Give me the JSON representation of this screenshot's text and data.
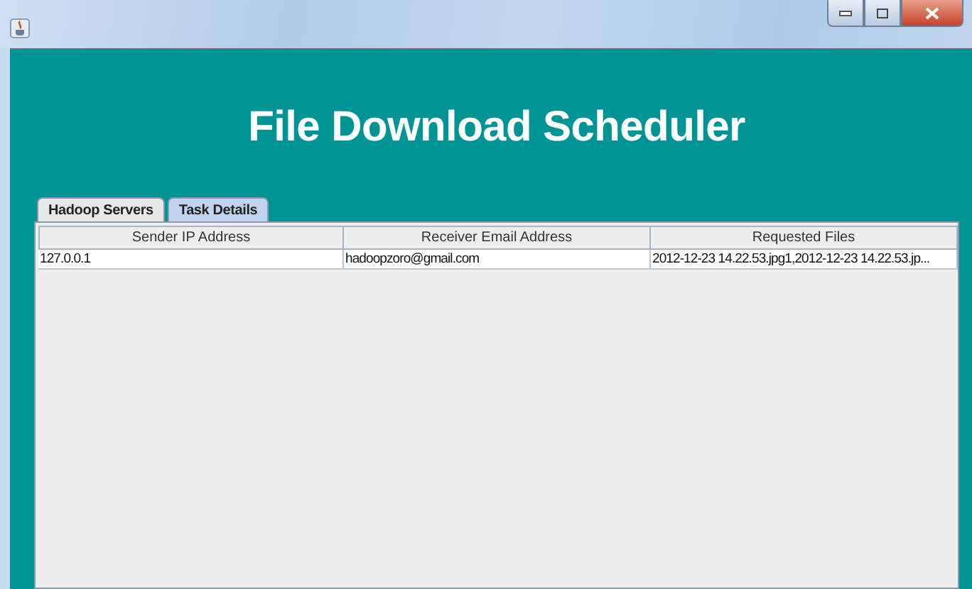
{
  "heading": "File Download Scheduler",
  "tabs": [
    {
      "label": "Hadoop Servers",
      "selected": false
    },
    {
      "label": "Task Details",
      "selected": true
    }
  ],
  "table": {
    "columns": [
      "Sender IP Address",
      "Receiver Email Address",
      "Requested Files"
    ],
    "rows": [
      [
        "127.0.0.1",
        "hadoopzoro@gmail.com",
        "2012-12-23 14.22.53.jpg1,2012-12-23 14.22.53.jp..."
      ]
    ]
  }
}
